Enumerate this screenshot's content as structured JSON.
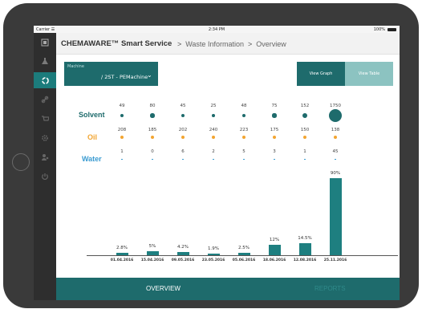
{
  "statusbar": {
    "carrier": "Carrier ☰",
    "time": "2:34 PM",
    "battery": "100%"
  },
  "header": {
    "brand": "CHEMAWARE™ Smart Service",
    "crumbs": [
      "Waste Information",
      "Overview"
    ]
  },
  "machine": {
    "label": "Machine",
    "value": "/ 2ST - PEMachine"
  },
  "view_toggle": {
    "graph": "View Graph",
    "table": "View Table",
    "selected": "graph"
  },
  "rows": [
    {
      "label": "Solvent",
      "color": "#1e6b6c",
      "values": [
        "49",
        "80",
        "45",
        "25",
        "48",
        "75",
        "152",
        "1750"
      ]
    },
    {
      "label": "Oil",
      "color": "#f2a531",
      "values": [
        "208",
        "185",
        "202",
        "240",
        "223",
        "175",
        "150",
        "138"
      ]
    },
    {
      "label": "Water",
      "color": "#3a9bd1",
      "values": [
        "1",
        "0",
        "6",
        "2",
        "5",
        "3",
        "1",
        "45"
      ]
    }
  ],
  "chart_data": {
    "type": "bar",
    "categories": [
      "01.04.2016",
      "15.04.2016",
      "09.05.2016",
      "23.05.2016",
      "05.06.2016",
      "18.06.2016",
      "12.08.2016",
      "25.11.2016"
    ],
    "values": [
      2.8,
      5,
      4.2,
      1.9,
      2.5,
      12,
      14.5,
      90
    ],
    "data_labels": [
      "2.8%",
      "5%",
      "4.2%",
      "1.9%",
      "2.5%",
      "12%",
      "14.5%",
      "90%"
    ],
    "ylim": [
      0,
      90
    ],
    "color": "#1e7f80"
  },
  "bottomnav": {
    "overview": "OVERVIEW",
    "reports": "REPORTS"
  }
}
